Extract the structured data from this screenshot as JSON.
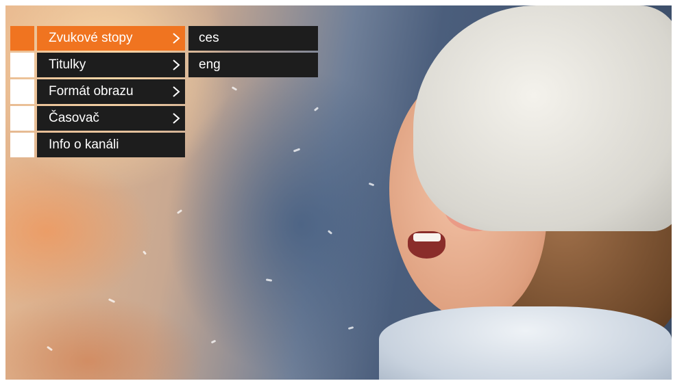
{
  "menu": {
    "items": [
      {
        "label": "Zvukové stopy",
        "active": true,
        "has_submenu": true
      },
      {
        "label": "Titulky",
        "active": false,
        "has_submenu": true
      },
      {
        "label": "Formát obrazu",
        "active": false,
        "has_submenu": true
      },
      {
        "label": "Časovač",
        "active": false,
        "has_submenu": true
      },
      {
        "label": "Info o kanáli",
        "active": false,
        "has_submenu": false
      }
    ]
  },
  "submenu": {
    "items": [
      {
        "label": "ces"
      },
      {
        "label": "eng"
      }
    ]
  },
  "colors": {
    "accent": "#f07420",
    "item_background": "#1d1d1d",
    "indicator_inactive": "#ffffff",
    "text": "#ffffff"
  },
  "icons": {
    "submenu_arrow": "chevron-right-icon"
  }
}
